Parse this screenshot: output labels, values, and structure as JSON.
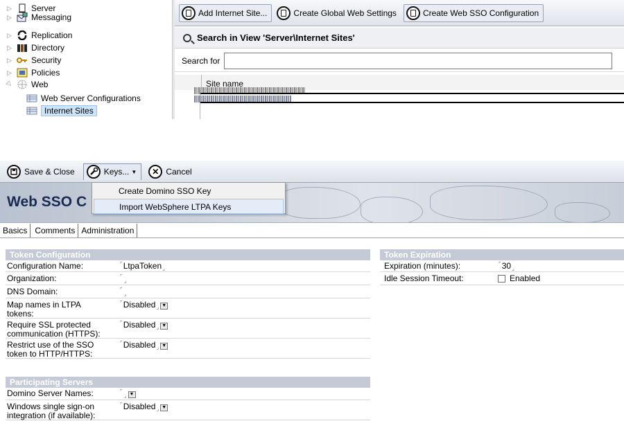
{
  "navigator": {
    "items": [
      {
        "label": "Server",
        "icon": "server-icon",
        "level": 0
      },
      {
        "label": "Messaging",
        "icon": "messaging-icon",
        "level": 0
      },
      {
        "label": "Replication",
        "icon": "replication-icon",
        "level": 0
      },
      {
        "label": "Directory",
        "icon": "directory-icon",
        "level": 0
      },
      {
        "label": "Security",
        "icon": "key-icon",
        "level": 0
      },
      {
        "label": "Policies",
        "icon": "policies-icon",
        "level": 0
      },
      {
        "label": "Web",
        "icon": "web-icon",
        "level": 0,
        "expanded": true
      },
      {
        "label": "Web Server Configurations",
        "icon": "view-icon",
        "level": 1
      },
      {
        "label": "Internet Sites",
        "icon": "view-icon",
        "level": 1,
        "selected": true
      }
    ]
  },
  "view": {
    "actions": [
      {
        "label": "Add Internet Site..."
      },
      {
        "label": "Create Global Web Settings"
      },
      {
        "label": "Create Web SSO Configuration"
      }
    ],
    "search_title": "Search in View 'Server\\Internet Sites'",
    "search_label": "Search for",
    "search_value": "",
    "columns": [
      "Site name"
    ]
  },
  "form": {
    "toolbar": {
      "save_close": "Save & Close",
      "keys": "Keys...",
      "cancel": "Cancel"
    },
    "keys_menu": [
      "Create Domino SSO Key",
      "Import WebSphere LTPA Keys"
    ],
    "banner_title": "Web SSO C",
    "tabs": [
      "Basics",
      "Comments",
      "Administration"
    ],
    "token_configuration": {
      "title": "Token Configuration",
      "fields": [
        {
          "label": "Configuration Name:",
          "value": "LtpaToken",
          "dropdown": false
        },
        {
          "label": "Organization:",
          "value": "",
          "dropdown": false
        },
        {
          "label": "DNS Domain:",
          "value": "",
          "dropdown": false
        },
        {
          "label": "Map names in LTPA tokens:",
          "value": "Disabled",
          "dropdown": true
        },
        {
          "label": "Require SSL protected communication (HTTPS):",
          "value": "Disabled",
          "dropdown": true
        },
        {
          "label": "Restrict use of the SSO token to HTTP/HTTPS:",
          "value": "Disabled",
          "dropdown": true
        }
      ]
    },
    "participating_servers": {
      "title": "Participating Servers",
      "fields": [
        {
          "label": "Domino Server Names:",
          "value": "",
          "dropdown": true
        },
        {
          "label": "Windows single sign-on integration (if available):",
          "value": "Disabled",
          "dropdown": true
        }
      ]
    },
    "token_expiration": {
      "title": "Token Expiration",
      "expiration_label": "Expiration (minutes):",
      "expiration_value": "30",
      "idle_label": "Idle Session Timeout:",
      "idle_checkbox_label": "Enabled",
      "idle_checked": false
    }
  },
  "colors": {
    "section_header": "#c5cbd6",
    "banner_title": "#1a2a52",
    "selection": "#cde4fb"
  }
}
